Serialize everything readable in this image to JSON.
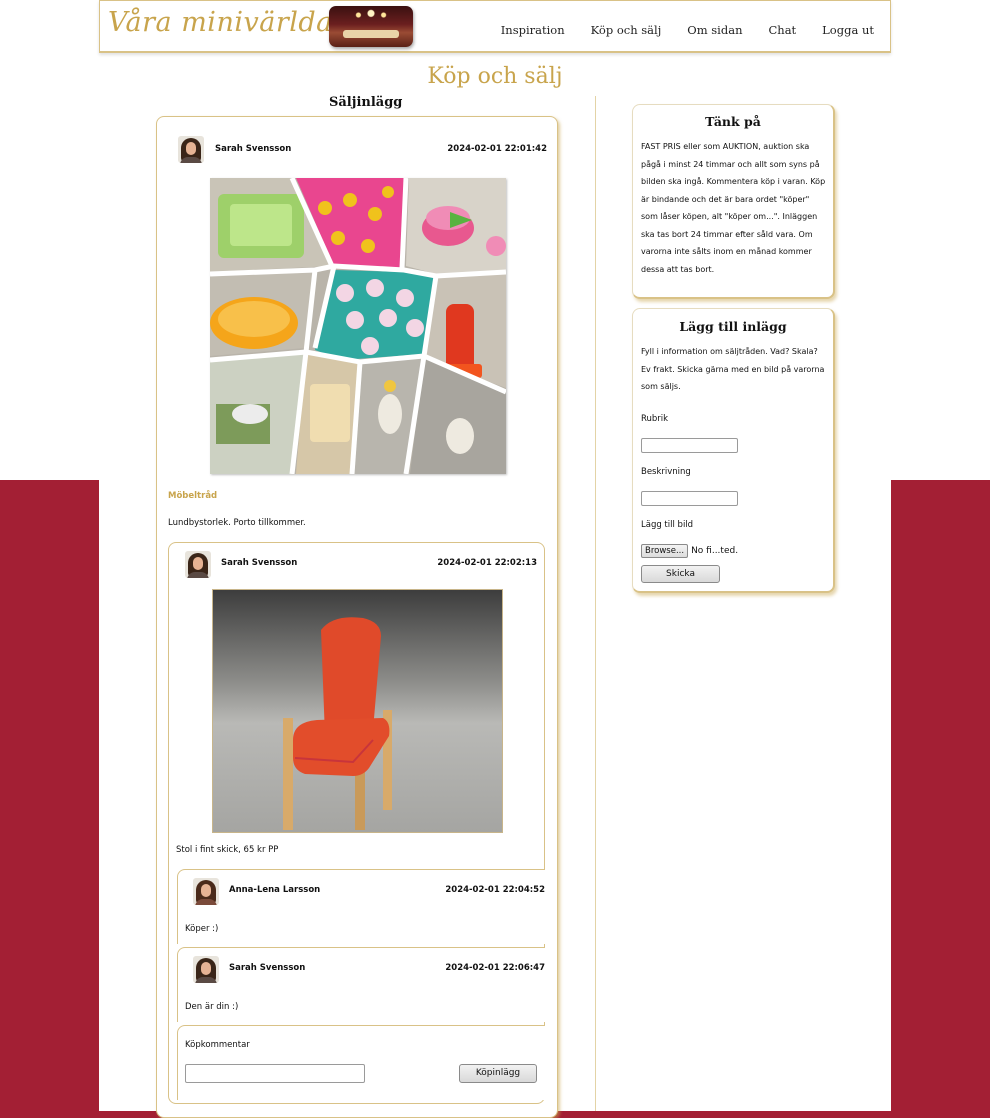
{
  "header": {
    "logo": "Våra minivärldar",
    "nav": [
      "Inspiration",
      "Köp och sälj",
      "Om sidan",
      "Chat",
      "Logga ut"
    ]
  },
  "page_title": "Köp och sälj",
  "left": {
    "section_title": "Säljinlägg",
    "post": {
      "author": "Sarah Svensson",
      "date": "2024-02-01 22:01:42",
      "subject": "Möbeltråd",
      "body": "Lundbystorlek. Porto tillkommer."
    },
    "comment": {
      "author": "Sarah Svensson",
      "date": "2024-02-01 22:02:13",
      "body": "Stol i fint skick, 65 kr PP"
    },
    "replies": [
      {
        "author": "Anna-Lena Larsson",
        "date": "2024-02-01 22:04:52",
        "body": "Köper :)"
      },
      {
        "author": "Sarah Svensson",
        "date": "2024-02-01 22:06:47",
        "body": "Den är din :)"
      }
    ],
    "buy_form": {
      "label": "Köpkommentar",
      "input_value": "",
      "button": "Köpinlägg"
    }
  },
  "right": {
    "notice": {
      "title": "Tänk på",
      "lines": [
        "FAST PRIS eller som AUKTION, auktion ska",
        "pågå i minst 24 timmar och allt som syns på",
        "bilden ska ingå. Kommentera köp i varan. Köp",
        "är bindande och det är bara ordet \"köper\"",
        "som låser köpen, alt \"köper om...\". Inläggen",
        "ska tas bort 24 timmar efter såld vara. Om",
        "varorna inte sålts inom en månad kommer",
        "dessa att tas bort."
      ]
    },
    "add_post": {
      "title": "Lägg till inlägg",
      "lines": [
        "Fyll i information om säljtråden. Vad? Skala?",
        "Ev frakt. Skicka gärna med en bild på varorna",
        "som säljs."
      ],
      "rubrik_label": "Rubrik",
      "rubrik_value": "",
      "beskrivning_label": "Beskrivning",
      "beskrivning_value": "",
      "image_label": "Lägg till bild",
      "browse_button": "Browse...",
      "file_status": "No fi...ted.",
      "submit_button": "Skicka"
    }
  }
}
